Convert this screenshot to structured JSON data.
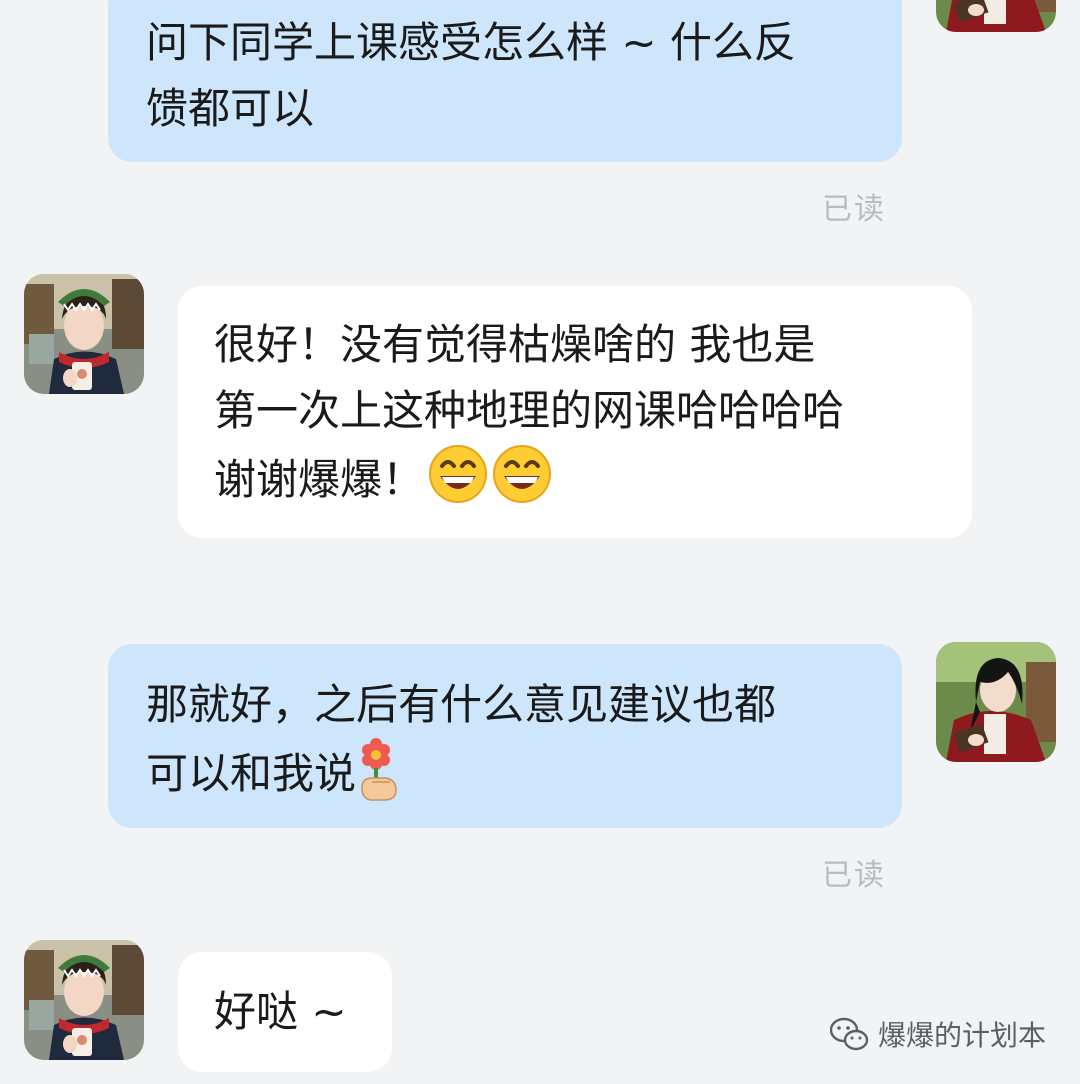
{
  "messages": [
    {
      "id": "m1",
      "side": "out",
      "lines": [
        "问下同学上课感受怎么样 ~ 什么反",
        "馈都可以"
      ],
      "read_status": "已读"
    },
    {
      "id": "m2",
      "side": "in",
      "lines": [
        "很好！没有觉得枯燥啥的 我也是",
        "第一次上这种地理的网课哈哈哈哈",
        "谢谢爆爆！"
      ],
      "emojis": [
        "grinning-face-icon",
        "grinning-face-icon"
      ]
    },
    {
      "id": "m3",
      "side": "out",
      "lines": [
        "那就好，之后有什么意见建议也都",
        "可以和我说"
      ],
      "emojis": [
        "hand-with-flower-icon"
      ],
      "read_status": "已读"
    },
    {
      "id": "m4",
      "side": "in",
      "lines": [
        "好哒 ~"
      ]
    }
  ],
  "watermark": {
    "label": "爆爆的计划本",
    "icon": "wechat-icon"
  },
  "colors": {
    "background": "#f2f3f5",
    "outgoing_bubble": "#cde6fc",
    "incoming_bubble": "#ffffff",
    "read_status": "#b8bcc2"
  }
}
